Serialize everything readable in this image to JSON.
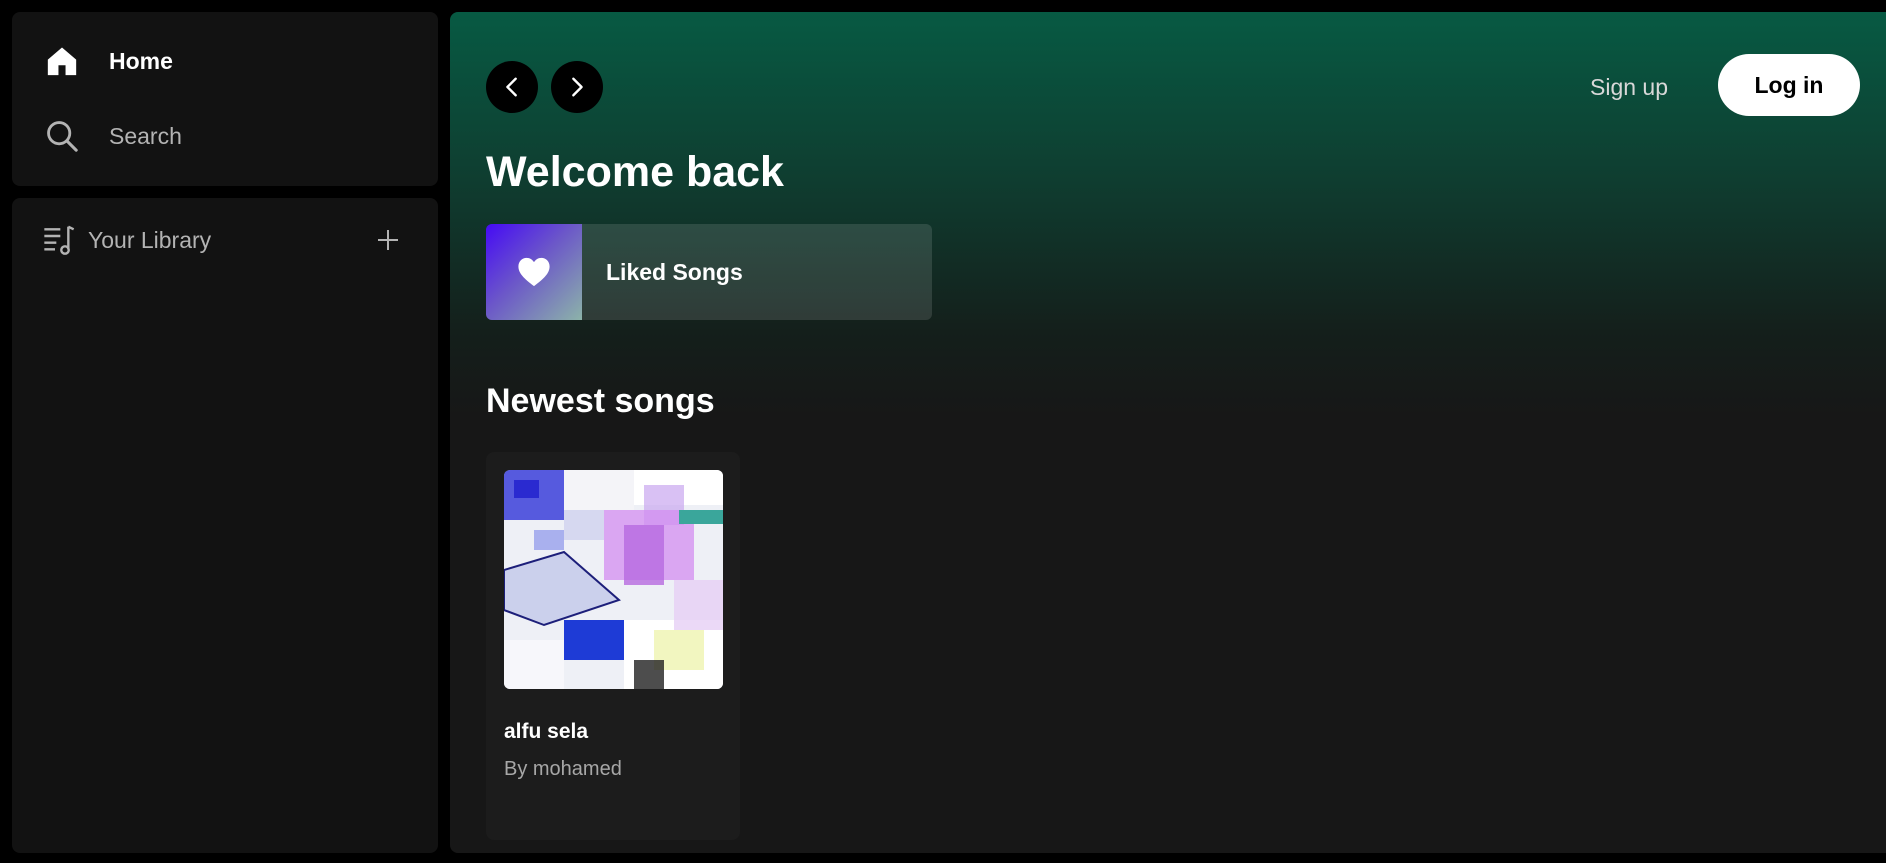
{
  "sidebar": {
    "home_label": "Home",
    "search_label": "Search",
    "library_label": "Your Library",
    "icons": {
      "home": "home-icon",
      "search": "search-icon",
      "library": "library-icon",
      "add": "plus-icon"
    }
  },
  "header": {
    "signup_label": "Sign up",
    "login_label": "Log in",
    "icons": {
      "back": "chevron-left-icon",
      "forward": "chevron-right-icon"
    }
  },
  "main": {
    "greeting": "Welcome back",
    "liked_songs_label": "Liked Songs",
    "section_title": "Newest songs",
    "songs": [
      {
        "title": "alfu sela",
        "artist": "By mohamed"
      }
    ]
  },
  "colors": {
    "accent_green": "#075a43",
    "panel_bg": "#121212",
    "liked_gradient_start": "#450af5"
  }
}
